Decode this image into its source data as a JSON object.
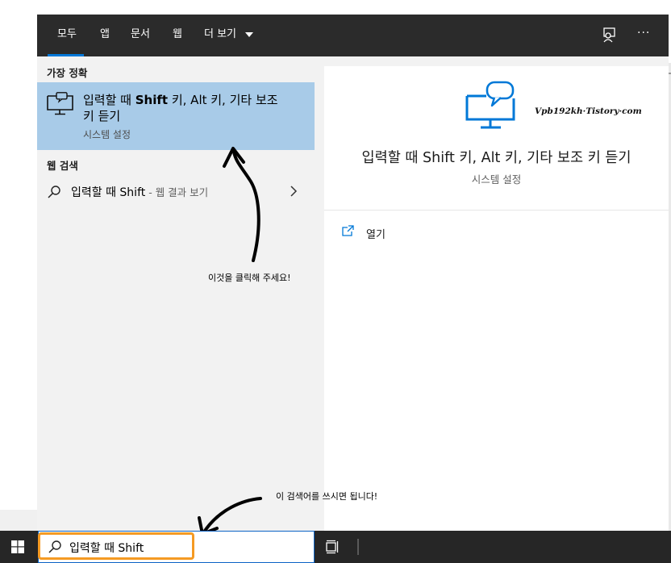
{
  "tabs": [
    {
      "label": "모두"
    },
    {
      "label": "앱"
    },
    {
      "label": "문서"
    },
    {
      "label": "웹"
    },
    {
      "label": "더 보기"
    }
  ],
  "top_icons": [
    "feedback-icon",
    "more-options-icon"
  ],
  "more_icon_text": "···",
  "best_match": {
    "section": "가장 정확",
    "title_prefix": "입력할 때 ",
    "title_bold": "Shift",
    "title_rest": " 키, Alt 키, 기타 보조 키 듣기",
    "subtitle": "시스템 설정"
  },
  "web_search": {
    "section": "웹 검색",
    "query": "입력할 때 Shift",
    "suffix": " - 웹 결과 보기"
  },
  "detail": {
    "title": "입력할 때 Shift 키, Alt 키, 기타 보조 키 듣기",
    "subtitle": "시스템 설정",
    "open_label": "열기",
    "watermark": "Vpb192kh·Tistory·com"
  },
  "annotations": {
    "click_hint": "이것을 클릭해 주세요!",
    "search_hint": "이 검색어를 쓰시면 됩니다!"
  },
  "taskbar": {
    "search_value": "입력할 때 Shift"
  },
  "colors": {
    "accent": "#0078d7",
    "selection": "#a8cbe8",
    "topbar": "#2b2b2b",
    "taskbar": "#262626",
    "highlight": "#f59a23"
  }
}
